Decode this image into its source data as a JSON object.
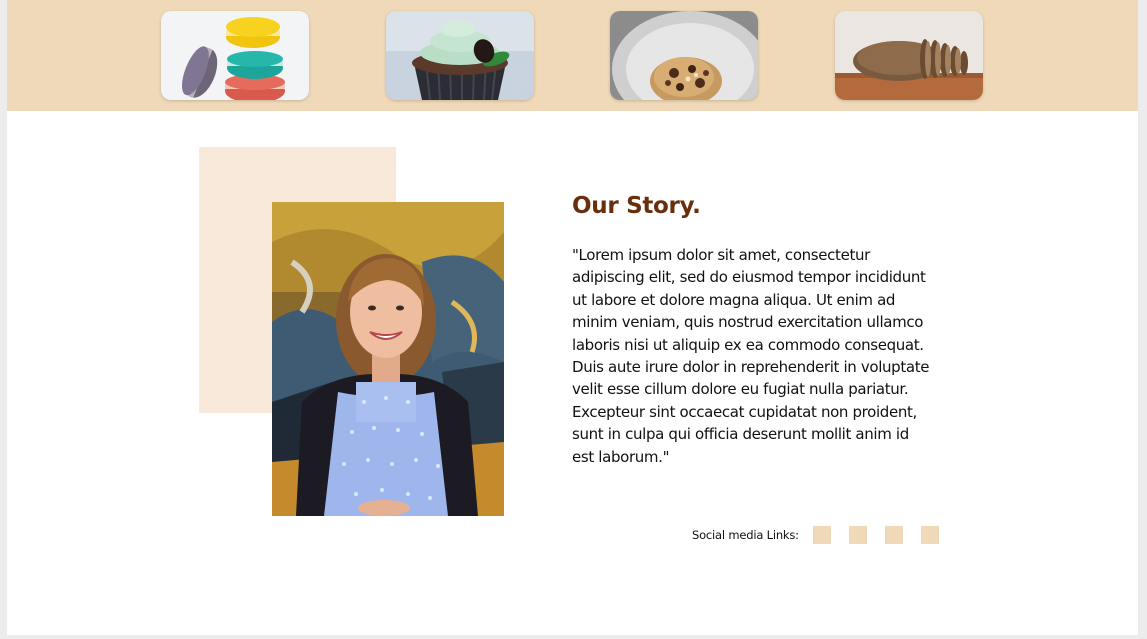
{
  "banner": {
    "background": "#f0d9b9",
    "thumbnails": [
      {
        "name": "macarons-image"
      },
      {
        "name": "cupcake-image"
      },
      {
        "name": "cookie-image"
      },
      {
        "name": "bread-image"
      }
    ]
  },
  "story": {
    "title": "Our Story.",
    "title_color": "#6b2e0b",
    "body": "\"Lorem ipsum dolor sit amet, consectetur adipiscing elit, sed do eiusmod tempor incididunt ut labore et dolore magna aliqua. Ut enim ad minim veniam, quis nostrud exercitation ullamco laboris nisi ut aliquip ex ea commodo consequat. Duis aute irure dolor in reprehenderit in voluptate velit esse cillum dolore eu fugiat nulla pariatur. Excepteur sint occaecat cupidatat non proident, sunt in culpa qui officia deserunt mollit anim id est laborum.\"",
    "accent_bg": "#f9e9da"
  },
  "social": {
    "label": "Social media Links:",
    "links": [
      {
        "name": "social-link-1"
      },
      {
        "name": "social-link-2"
      },
      {
        "name": "social-link-3"
      },
      {
        "name": "social-link-4"
      }
    ],
    "box_color": "#f0d9b9"
  }
}
